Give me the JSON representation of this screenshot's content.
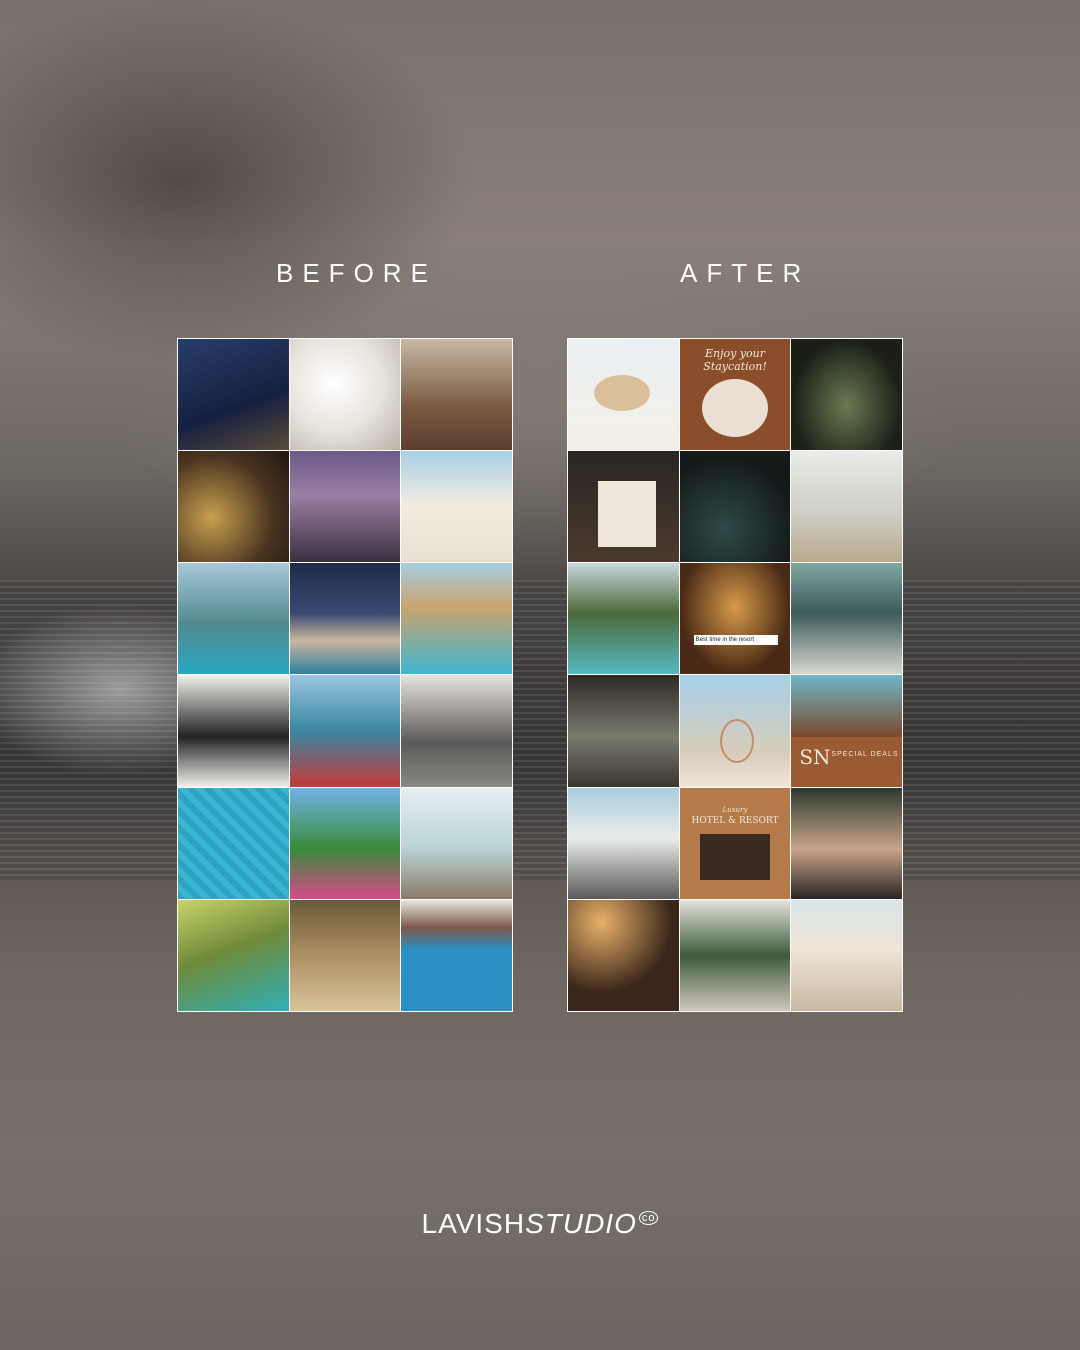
{
  "labels": {
    "before": "BEFORE",
    "after": "AFTER"
  },
  "brand": {
    "name_regular": "LAVISH",
    "name_italic": "STUDIO",
    "mark": "co"
  },
  "after_tiles": {
    "stay_title": "Enjoy your Staycation!",
    "search_text": "Best time in the resort",
    "special_deals": "SPECIAL DEALS",
    "special_deals_monogram": "SN",
    "resort_tag": "Luxury",
    "resort_title": "HOTEL & RESORT"
  },
  "colors": {
    "accent_brown": "#8a4f2a",
    "text_white": "#ffffff"
  }
}
